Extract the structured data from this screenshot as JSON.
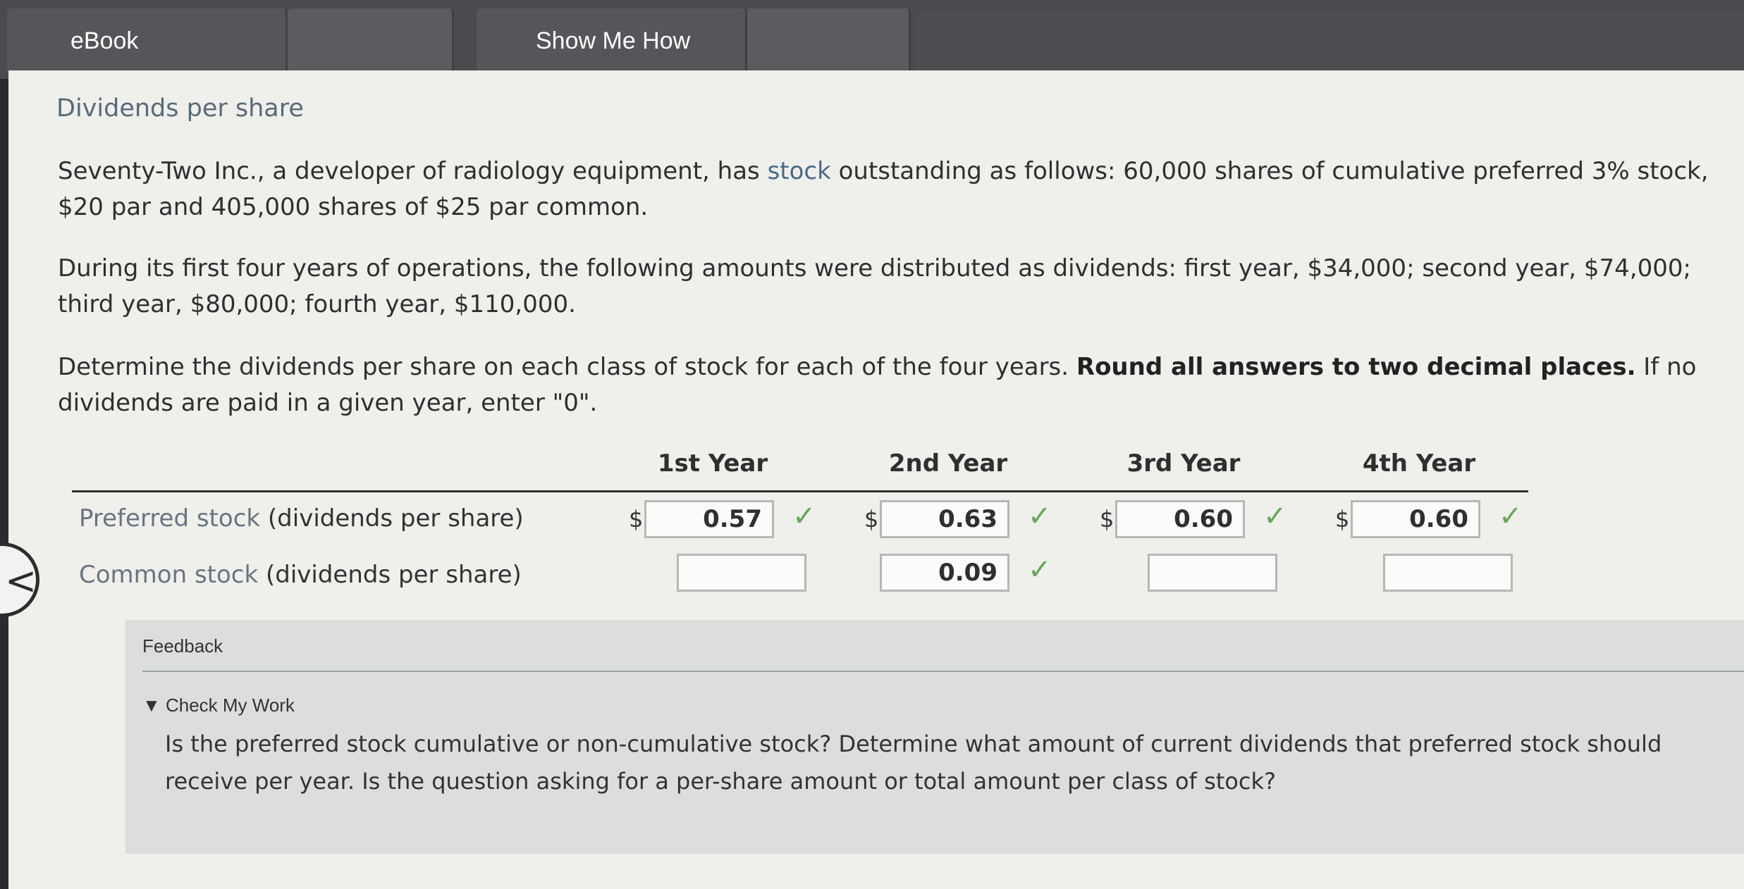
{
  "toolbar": {
    "ebook_label": "eBook",
    "show_me_how_label": "Show Me How"
  },
  "section": {
    "title": "Dividends per share"
  },
  "problem": {
    "p1_before": "Seventy-Two Inc., a developer of radiology equipment, has ",
    "p1_link": "stock",
    "p1_after": " outstanding as follows: 60,000 shares of cumulative preferred 3% stock, $20 par and 405,000 shares of $25 par common.",
    "p2": "During its first four years of operations, the following amounts were distributed as dividends: first year, $34,000; second year, $74,000; third year, $80,000; fourth year, $110,000.",
    "p3_before": "Determine the dividends per share on each class of stock for each of the four years. ",
    "p3_bold": "Round all answers to two decimal places.",
    "p3_after": " If no dividends are paid in a given year, enter \"0\"."
  },
  "table": {
    "headers": [
      "1st Year",
      "2nd Year",
      "3rd Year",
      "4th Year"
    ],
    "currency_symbol": "$",
    "rows": [
      {
        "label": "Preferred stock",
        "suffix": " (dividends per share)",
        "values": [
          "0.57",
          "0.63",
          "0.60",
          "0.60"
        ],
        "checks": [
          true,
          true,
          true,
          true
        ]
      },
      {
        "label": "Common stock",
        "suffix": " (dividends per share)",
        "values": [
          "",
          "0.09",
          "",
          ""
        ],
        "checks": [
          false,
          true,
          false,
          false
        ]
      }
    ],
    "check_mark": "✓",
    "check_color": "#6aa65a"
  },
  "feedback": {
    "title": "Feedback",
    "toggle_label": "Check My Work",
    "toggle_icon": "▼",
    "text": "Is the preferred stock cumulative or non-cumulative stock? Determine what amount of current dividends that preferred stock should receive per year. Is the question asking for a per-share amount or total amount per class of stock?"
  },
  "nav": {
    "back_glyph": "<"
  }
}
